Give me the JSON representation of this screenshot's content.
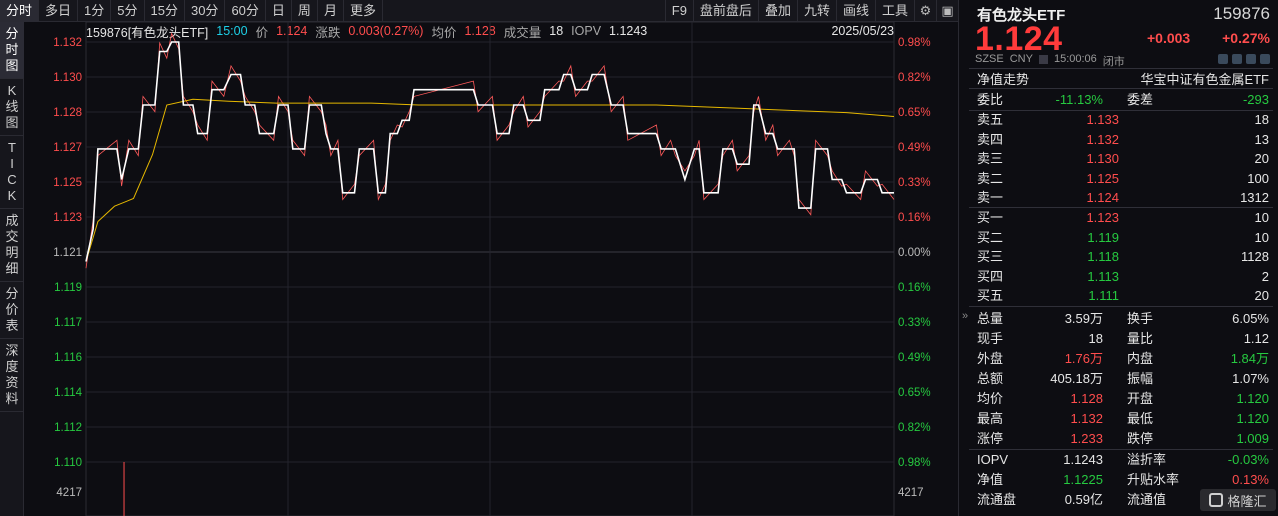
{
  "toolbar": {
    "tabs": [
      "分时",
      "多日",
      "1分",
      "5分",
      "15分",
      "30分",
      "60分",
      "日",
      "周",
      "月",
      "更多"
    ],
    "tools": [
      "F9",
      "盘前盘后",
      "叠加",
      "九转",
      "画线",
      "工具"
    ],
    "icons": [
      "settings-icon",
      "layout-icon"
    ]
  },
  "vtabs": [
    "分\n时\n图",
    "K\n线\n图",
    "T\nI\nC\nK",
    "成\n交\n明\n细",
    "分\n价\n表",
    "深\n度\n资\n料"
  ],
  "chart_header": {
    "code_name": "159876[有色龙头ETF]",
    "time": "15:00",
    "price_label": "价",
    "price": "1.124",
    "change_label": "涨跌",
    "change": "0.003(0.27%)",
    "avg_label": "均价",
    "avg": "1.128",
    "volume_label": "成交量",
    "volume": "18",
    "iopv_label": "IOPV",
    "iopv": "1.1243",
    "date": "2025/05/23"
  },
  "chart_data": {
    "type": "line",
    "title": "",
    "prev_close": 1.121,
    "price_ticks": [
      "1.132",
      "1.130",
      "1.128",
      "1.127",
      "1.125",
      "1.123",
      "1.121",
      "1.119",
      "1.117",
      "1.116",
      "1.114",
      "1.112",
      "1.110"
    ],
    "pct_ticks": [
      "0.98%",
      "0.82%",
      "0.65%",
      "0.49%",
      "0.33%",
      "0.16%",
      "0.00%",
      "0.16%",
      "0.33%",
      "0.49%",
      "0.65%",
      "0.82%",
      "0.98%"
    ],
    "volume_scale_label": "4217",
    "ylim": [
      1.11,
      1.132
    ],
    "x_minutes": 240,
    "series": [
      {
        "color": "#ffffff",
        "points": [
          [
            0,
            1.1205
          ],
          [
            3,
            1.1222
          ],
          [
            5,
            1.1264
          ],
          [
            13,
            1.1264
          ],
          [
            15,
            1.1248
          ],
          [
            18,
            1.1264
          ],
          [
            22,
            1.1264
          ],
          [
            24,
            1.1287
          ],
          [
            29,
            1.1287
          ],
          [
            31,
            1.1315
          ],
          [
            34,
            1.1315
          ],
          [
            36,
            1.132
          ],
          [
            39,
            1.132
          ],
          [
            41,
            1.1287
          ],
          [
            45,
            1.1287
          ],
          [
            47,
            1.1272
          ],
          [
            51,
            1.1272
          ],
          [
            53,
            1.1295
          ],
          [
            58,
            1.1295
          ],
          [
            61,
            1.1303
          ],
          [
            65,
            1.1303
          ],
          [
            67,
            1.1287
          ],
          [
            71,
            1.1287
          ],
          [
            73,
            1.1272
          ],
          [
            79,
            1.1272
          ],
          [
            81,
            1.1287
          ],
          [
            85,
            1.1287
          ],
          [
            87,
            1.1264
          ],
          [
            92,
            1.1264
          ],
          [
            94,
            1.1287
          ],
          [
            99,
            1.1287
          ],
          [
            101,
            1.1272
          ],
          [
            103,
            1.1264
          ],
          [
            106,
            1.1264
          ],
          [
            108,
            1.1241
          ],
          [
            113,
            1.1241
          ],
          [
            115,
            1.1264
          ],
          [
            121,
            1.1264
          ],
          [
            123,
            1.1241
          ],
          [
            126,
            1.1241
          ],
          [
            128,
            1.1272
          ],
          [
            131,
            1.1272
          ],
          [
            133,
            1.1279
          ],
          [
            136,
            1.1279
          ],
          [
            138,
            1.1295
          ],
          [
            163,
            1.1295
          ],
          [
            165,
            1.1287
          ],
          [
            171,
            1.1287
          ],
          [
            173,
            1.1272
          ],
          [
            178,
            1.1272
          ],
          [
            180,
            1.1287
          ],
          [
            184,
            1.1287
          ],
          [
            186,
            1.1279
          ],
          [
            191,
            1.1279
          ],
          [
            193,
            1.1295
          ],
          [
            199,
            1.1295
          ],
          [
            201,
            1.1303
          ],
          [
            204,
            1.1303
          ],
          [
            206,
            1.1295
          ],
          [
            211,
            1.1295
          ],
          [
            213,
            1.1303
          ],
          [
            218,
            1.1303
          ],
          [
            221,
            1.1287
          ],
          [
            226,
            1.1287
          ],
          [
            228,
            1.1272
          ],
          [
            240,
            1.1272
          ]
        ]
      },
      {
        "color": "#ffffff",
        "points": [
          [
            240,
            1.1272
          ],
          [
            242,
            1.1264
          ],
          [
            246,
            1.1264
          ],
          [
            248,
            1.1264
          ],
          [
            252,
            1.1248
          ],
          [
            256,
            1.1264
          ],
          [
            258,
            1.1264
          ],
          [
            260,
            1.1241
          ],
          [
            266,
            1.1241
          ],
          [
            268,
            1.1264
          ],
          [
            272,
            1.1264
          ],
          [
            274,
            1.1256
          ],
          [
            279,
            1.1256
          ],
          [
            281,
            1.1287
          ],
          [
            283,
            1.1287
          ],
          [
            286,
            1.1272
          ],
          [
            289,
            1.1272
          ],
          [
            291,
            1.1264
          ],
          [
            296,
            1.1264
          ],
          [
            298,
            1.1264
          ],
          [
            300,
            1.1233
          ],
          [
            305,
            1.1233
          ],
          [
            307,
            1.1264
          ],
          [
            312,
            1.1264
          ],
          [
            314,
            1.1248
          ],
          [
            318,
            1.1248
          ],
          [
            320,
            1.1241
          ],
          [
            326,
            1.1241
          ],
          [
            328,
            1.1248
          ],
          [
            333,
            1.1248
          ],
          [
            335,
            1.1241
          ],
          [
            340,
            1.1241
          ]
        ]
      }
    ],
    "avg_series": {
      "color": "#e6b800",
      "points": [
        [
          0,
          1.1205
        ],
        [
          5,
          1.1226
        ],
        [
          12,
          1.1234
        ],
        [
          20,
          1.1238
        ],
        [
          28,
          1.1261
        ],
        [
          34,
          1.1287
        ],
        [
          45,
          1.129
        ],
        [
          60,
          1.1289
        ],
        [
          80,
          1.1288
        ],
        [
          100,
          1.1288
        ],
        [
          120,
          1.1288
        ],
        [
          140,
          1.1287
        ],
        [
          160,
          1.1287
        ],
        [
          180,
          1.1287
        ],
        [
          200,
          1.1287
        ],
        [
          220,
          1.1287
        ],
        [
          240,
          1.1287
        ],
        [
          260,
          1.1286
        ],
        [
          280,
          1.1285
        ],
        [
          300,
          1.1284
        ],
        [
          320,
          1.1283
        ],
        [
          340,
          1.1281
        ]
      ]
    }
  },
  "quote": {
    "name": "有色龙头ETF",
    "code": "159876",
    "price": "1.124",
    "change": "+0.003",
    "change_pct": "+0.27%",
    "meta_sz": "SZSE",
    "meta_cur": "CNY",
    "meta_time": "15:00:06",
    "meta_status": "闭市",
    "nav_label": "净值走势",
    "index_name": "华宝中证有色金属ETF",
    "wb_label": "委比",
    "wb_value": "-11.13%",
    "wc_label": "委差",
    "wc_value": "-293",
    "asks": [
      {
        "label": "卖五",
        "price": "1.133",
        "vol": "18"
      },
      {
        "label": "卖四",
        "price": "1.132",
        "vol": "13"
      },
      {
        "label": "卖三",
        "price": "1.130",
        "vol": "20"
      },
      {
        "label": "卖二",
        "price": "1.125",
        "vol": "100"
      },
      {
        "label": "卖一",
        "price": "1.124",
        "vol": "1312"
      }
    ],
    "bids": [
      {
        "label": "买一",
        "price": "1.123",
        "vol": "10"
      },
      {
        "label": "买二",
        "price": "1.119",
        "vol": "10"
      },
      {
        "label": "买三",
        "price": "1.118",
        "vol": "1128"
      },
      {
        "label": "买四",
        "price": "1.113",
        "vol": "2"
      },
      {
        "label": "买五",
        "price": "1.111",
        "vol": "20"
      }
    ],
    "stats": [
      {
        "l1": "总量",
        "v1": "3.59万",
        "c1": "white",
        "l2": "换手",
        "v2": "6.05%",
        "c2": "white"
      },
      {
        "l1": "现手",
        "v1": "18",
        "c1": "white",
        "l2": "量比",
        "v2": "1.12",
        "c2": "white"
      },
      {
        "l1": "外盘",
        "v1": "1.76万",
        "c1": "red",
        "l2": "内盘",
        "v2": "1.84万",
        "c2": "green"
      },
      {
        "l1": "总额",
        "v1": "405.18万",
        "c1": "white",
        "l2": "振幅",
        "v2": "1.07%",
        "c2": "white"
      },
      {
        "l1": "均价",
        "v1": "1.128",
        "c1": "red",
        "l2": "开盘",
        "v2": "1.120",
        "c2": "green"
      },
      {
        "l1": "最高",
        "v1": "1.132",
        "c1": "red",
        "l2": "最低",
        "v2": "1.120",
        "c2": "green"
      },
      {
        "l1": "涨停",
        "v1": "1.233",
        "c1": "red",
        "l2": "跌停",
        "v2": "1.009",
        "c2": "green"
      }
    ],
    "etf": [
      {
        "l1": "IOPV",
        "v1": "1.1243",
        "c1": "white",
        "l2": "溢折率",
        "v2": "-0.03%",
        "c2": "green"
      },
      {
        "l1": "净值",
        "v1": "1.1225",
        "c1": "green",
        "l2": "升贴水率",
        "v2": "0.13%",
        "c2": "red"
      },
      {
        "l1": "流通盘",
        "v1": "0.59亿",
        "c1": "white",
        "l2": "流通值",
        "v2": "",
        "c2": "white"
      }
    ]
  },
  "watermark": "格隆汇",
  "colors": {
    "up": "#ff4d4d",
    "down": "#26c940",
    "avg": "#e6b800",
    "grid": "#2a2a33"
  }
}
